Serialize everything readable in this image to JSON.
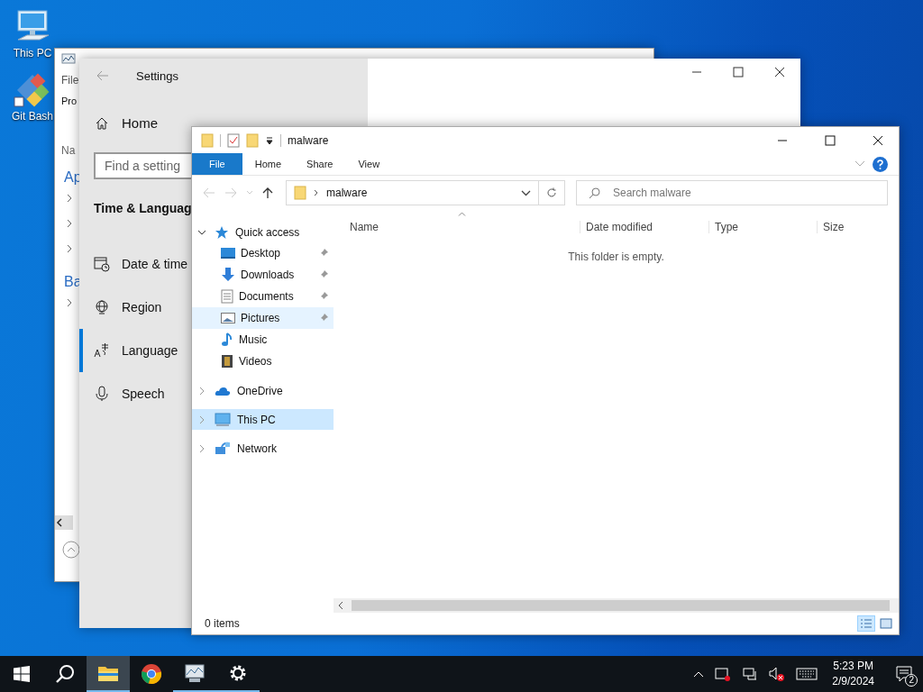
{
  "desktop_icons": [
    {
      "label": "This PC",
      "kind": "computer"
    },
    {
      "label": "Git Bash",
      "kind": "gitbash"
    }
  ],
  "back_window": {
    "menu": "File",
    "tab": "Pro",
    "column": "Na",
    "items": [
      {
        "kind": "heading",
        "label": "Ap"
      },
      {
        "kind": "row"
      },
      {
        "kind": "row"
      },
      {
        "kind": "row"
      },
      {
        "kind": "heading",
        "label": "Ba"
      },
      {
        "kind": "row"
      }
    ]
  },
  "settings": {
    "title": "Settings",
    "home": "Home",
    "search": {
      "placeholder": "Find a setting"
    },
    "section": "Time & Languag",
    "items": [
      {
        "label": "Date & time",
        "kind": "calendar",
        "selected": false
      },
      {
        "label": "Region",
        "kind": "globe",
        "selected": false
      },
      {
        "label": "Language",
        "kind": "language",
        "selected": true
      },
      {
        "label": "Speech",
        "kind": "microphone",
        "selected": false
      }
    ]
  },
  "explorer": {
    "title": "malware",
    "ribbon_tabs": [
      {
        "label": "File",
        "selected": true
      },
      {
        "label": "Home",
        "selected": false
      },
      {
        "label": "Share",
        "selected": false
      },
      {
        "label": "View",
        "selected": false
      }
    ],
    "address": "malware",
    "search": {
      "placeholder": "Search malware"
    },
    "columns": [
      "Name",
      "Date modified",
      "Type",
      "Size"
    ],
    "empty_message": "This folder is empty.",
    "nav": [
      {
        "label": "Quick access",
        "kind": "star",
        "expanded": true,
        "selected": false,
        "hovered": false,
        "children": [
          {
            "label": "Desktop",
            "kind": "desktop",
            "pinned": true,
            "hovered": false
          },
          {
            "label": "Downloads",
            "kind": "download",
            "pinned": true,
            "hovered": false
          },
          {
            "label": "Documents",
            "kind": "document",
            "pinned": true,
            "hovered": false
          },
          {
            "label": "Pictures",
            "kind": "pictures",
            "pinned": true,
            "hovered": true
          },
          {
            "label": "Music",
            "kind": "music",
            "pinned": false,
            "hovered": false
          },
          {
            "label": "Videos",
            "kind": "videos",
            "pinned": false,
            "hovered": false
          }
        ]
      },
      {
        "label": "OneDrive",
        "kind": "cloud",
        "expanded": false,
        "selected": false,
        "hovered": false
      },
      {
        "label": "This PC",
        "kind": "computer",
        "expanded": false,
        "selected": true,
        "hovered": false
      },
      {
        "label": "Network",
        "kind": "network",
        "expanded": false,
        "selected": false,
        "hovered": false
      }
    ],
    "status": "0 items"
  },
  "taskbar": {
    "apps": [
      {
        "kind": "explorer",
        "open": true,
        "active": true
      },
      {
        "kind": "chrome",
        "open": false,
        "active": false
      },
      {
        "kind": "taskmanager",
        "open": true,
        "active": false
      },
      {
        "kind": "settings",
        "open": true,
        "active": false
      }
    ],
    "time": "5:23 PM",
    "date": "2/9/2024",
    "notifications": "2"
  }
}
